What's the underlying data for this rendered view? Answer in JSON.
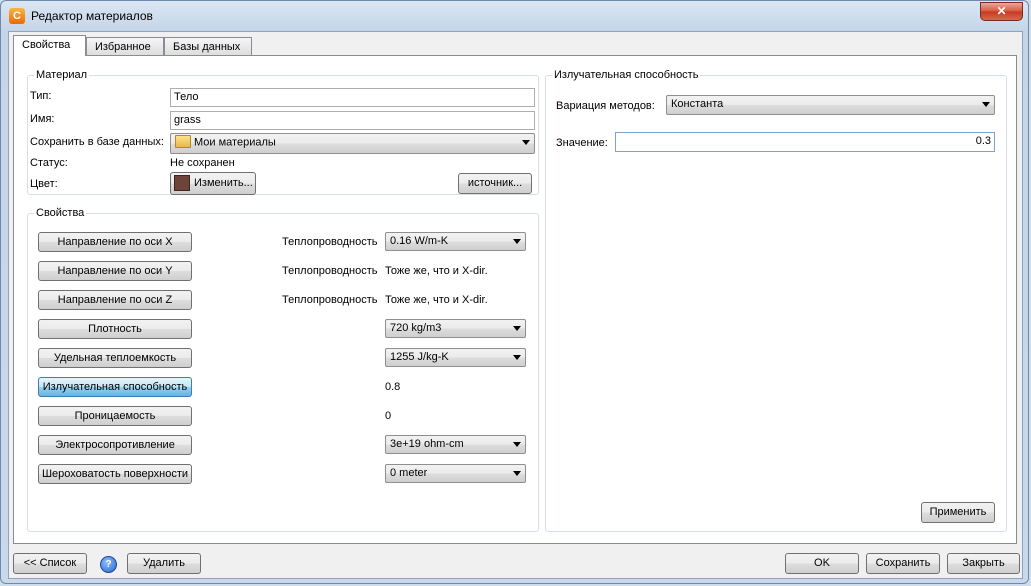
{
  "window": {
    "title": "Редактор материалов",
    "app_icon": "app-logo-icon"
  },
  "tabs": [
    {
      "label": "Свойства",
      "active": true
    },
    {
      "label": "Избранное",
      "active": false
    },
    {
      "label": "Базы данных",
      "active": false
    }
  ],
  "material": {
    "group_title": "Материал",
    "type_label": "Тип:",
    "type_value": "Тело",
    "name_label": "Имя:",
    "name_value": "grass",
    "save_db_label": "Сохранить в базе данных:",
    "save_db_value": "Мои материалы",
    "status_label": "Статус:",
    "status_value": "Не сохранен",
    "color_label": "Цвет:",
    "color_swatch": "#6e443a",
    "change_button": "Изменить...",
    "source_button": "источник..."
  },
  "properties": {
    "group_title": "Свойства",
    "rows": [
      {
        "button": "Направление по оси X",
        "param_label": "Теплопроводность",
        "value": "0.16 W/m-K",
        "kind": "combo"
      },
      {
        "button": "Направление по оси Y",
        "param_label": "Теплопроводность",
        "value": "Тоже же, что и X-dir.",
        "kind": "text"
      },
      {
        "button": "Направление по оси Z",
        "param_label": "Теплопроводность",
        "value": "Тоже же, что и X-dir.",
        "kind": "text"
      },
      {
        "button": "Плотность",
        "param_label": "",
        "value": "720 kg/m3",
        "kind": "combo"
      },
      {
        "button": "Удельная теплоемкость",
        "param_label": "",
        "value": "1255 J/kg-K",
        "kind": "combo"
      },
      {
        "button": "Излучательная способность",
        "param_label": "",
        "value": "0.8",
        "kind": "text",
        "selected": true
      },
      {
        "button": "Проницаемость",
        "param_label": "",
        "value": "0",
        "kind": "text"
      },
      {
        "button": "Электросопротивление",
        "param_label": "",
        "value": "3e+19 ohm-cm",
        "kind": "combo"
      },
      {
        "button": "Шероховатость поверхности",
        "param_label": "",
        "value": "0 meter",
        "kind": "combo"
      }
    ]
  },
  "emissivity": {
    "group_title": "Излучательная способность",
    "method_label": "Вариация методов:",
    "method_value": "Константа",
    "value_label": "Значение:",
    "value": "0.3",
    "apply_button": "Применить"
  },
  "bottom": {
    "list_button": "<< Список",
    "delete_button": "Удалить",
    "ok_button": "OK",
    "save_button": "Сохранить",
    "close_button": "Закрыть"
  },
  "colors": {
    "selected_button": "#98d1ef",
    "window_frame": "#c9d8ea"
  }
}
